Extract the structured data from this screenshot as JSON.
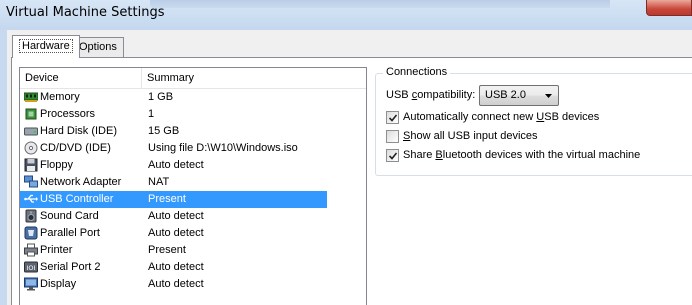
{
  "window": {
    "title": "Virtual Machine Settings"
  },
  "tabs": [
    {
      "label": "Hardware",
      "active": true
    },
    {
      "label": "Options",
      "active": false
    }
  ],
  "device_list": {
    "columns": [
      "Device",
      "Summary"
    ],
    "rows": [
      {
        "device": "Memory",
        "summary": "1 GB",
        "icon": "memory-icon"
      },
      {
        "device": "Processors",
        "summary": "1",
        "icon": "processor-icon"
      },
      {
        "device": "Hard Disk (IDE)",
        "summary": "15 GB",
        "icon": "hard-disk-icon"
      },
      {
        "device": "CD/DVD (IDE)",
        "summary": "Using file D:\\W10\\Windows.iso",
        "icon": "cd-dvd-icon"
      },
      {
        "device": "Floppy",
        "summary": "Auto detect",
        "icon": "floppy-icon"
      },
      {
        "device": "Network Adapter",
        "summary": "NAT",
        "icon": "network-adapter-icon"
      },
      {
        "device": "USB Controller",
        "summary": "Present",
        "icon": "usb-icon",
        "selected": true
      },
      {
        "device": "Sound Card",
        "summary": "Auto detect",
        "icon": "sound-card-icon"
      },
      {
        "device": "Parallel Port",
        "summary": "Auto detect",
        "icon": "parallel-port-icon"
      },
      {
        "device": "Printer",
        "summary": "Present",
        "icon": "printer-icon"
      },
      {
        "device": "Serial Port 2",
        "summary": "Auto detect",
        "icon": "serial-port-icon"
      },
      {
        "device": "Display",
        "summary": "Auto detect",
        "icon": "display-icon"
      }
    ]
  },
  "connections": {
    "legend": "Connections",
    "compat_label_pre": "USB ",
    "compat_label_ul": "c",
    "compat_label_post": "ompatibility:",
    "compat_value": "USB 2.0",
    "checks": [
      {
        "pre": "Automatically connect new ",
        "ul": "U",
        "post": "SB devices",
        "checked": true
      },
      {
        "pre": "",
        "ul": "S",
        "post": "how all USB input devices",
        "checked": false
      },
      {
        "pre": "Share ",
        "ul": "B",
        "post": "luetooth devices with the virtual machine",
        "checked": true
      }
    ]
  },
  "colors": {
    "selection": "#3399ff",
    "titlebar": "#c6d9ef",
    "close": "#c9473a"
  }
}
